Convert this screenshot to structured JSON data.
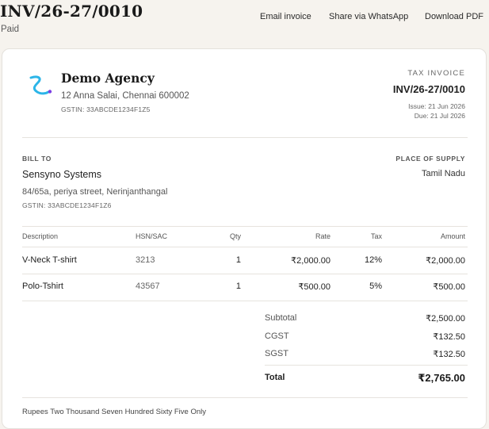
{
  "header": {
    "invoice_number": "INV/26-27/0010",
    "status": "Paid",
    "actions": {
      "email": "Email invoice",
      "whatsapp": "Share via WhatsApp",
      "download": "Download PDF"
    }
  },
  "company": {
    "name": "Demo Agency",
    "address": "12 Anna Salai, Chennai 600002",
    "gstin": "GSTIN: 33ABCDE1234F1Z5",
    "logo_icon": "s-curve-logo-icon",
    "logo_color": "#2cb5e8"
  },
  "document": {
    "type": "TAX INVOICE",
    "number": "INV/26-27/0010",
    "issue": "Issue: 21 Jun 2026",
    "due": "Due: 21 Jul 2026"
  },
  "bill_to": {
    "label": "BILL TO",
    "name": "Sensyno Systems",
    "address": "84/65a, periya street, Nerinjanthangal",
    "gstin": "GSTIN: 33ABCDE1234F1Z6"
  },
  "place_of_supply": {
    "label": "PLACE OF SUPPLY",
    "value": "Tamil Nadu"
  },
  "table": {
    "columns": [
      "Description",
      "HSN/SAC",
      "Qty",
      "Rate",
      "Tax",
      "Amount"
    ],
    "rows": [
      {
        "description": "V-Neck T-shirt",
        "hsn": "3213",
        "qty": "1",
        "rate": "₹2,000.00",
        "tax": "12%",
        "amount": "₹2,000.00"
      },
      {
        "description": "Polo-Tshirt",
        "hsn": "43567",
        "qty": "1",
        "rate": "₹500.00",
        "tax": "5%",
        "amount": "₹500.00"
      }
    ]
  },
  "summary": {
    "subtotal_label": "Subtotal",
    "subtotal": "₹2,500.00",
    "cgst_label": "CGST",
    "cgst": "₹132.50",
    "sgst_label": "SGST",
    "sgst": "₹132.50",
    "total_label": "Total",
    "total": "₹2,765.00"
  },
  "amount_in_words": "Rupees Two Thousand Seven Hundred Sixty Five Only"
}
